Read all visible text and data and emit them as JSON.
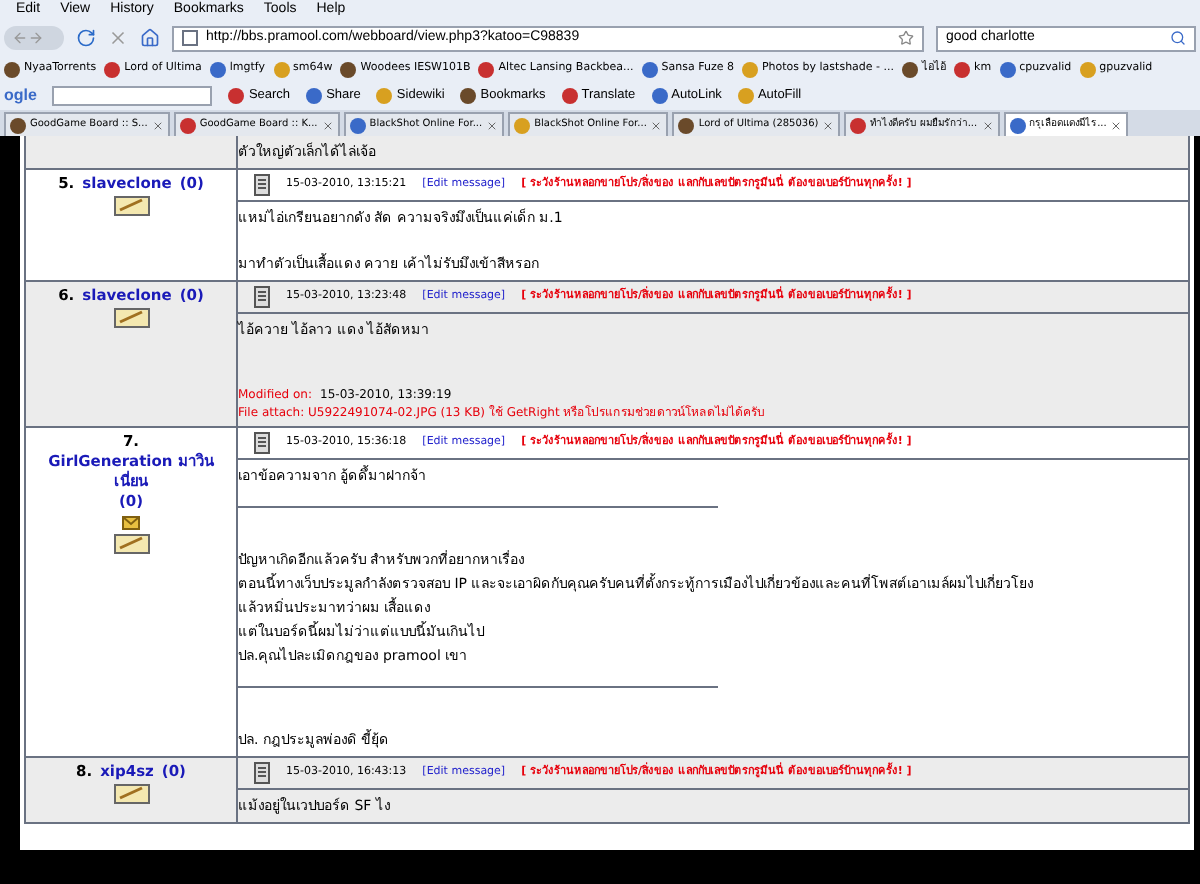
{
  "menu": [
    "Edit",
    "View",
    "History",
    "Bookmarks",
    "Tools",
    "Help"
  ],
  "address": {
    "value": "http://bbs.pramool.com/webboard/view.php3?katoo=C98839"
  },
  "search_field": {
    "value": "good charlotte"
  },
  "bookmarks": [
    "NyaaTorrents",
    "Lord of Ultima",
    "lmgtfy",
    "sm64w",
    "Woodees IESW101B",
    "Altec Lansing Backbea...",
    "Sansa Fuze 8",
    "Photos by lastshade - ...",
    "ไอไอ้",
    "km",
    "cpuzvalid",
    "gpuzvalid"
  ],
  "google_toolbar": {
    "logo": "ogle",
    "items": [
      "Search",
      "Share",
      "Sidewiki",
      "Bookmarks",
      "Translate",
      "AutoLink",
      "AutoFill"
    ]
  },
  "tabs": [
    {
      "label": "GoodGame Board :: S...",
      "selected": false
    },
    {
      "label": "GoodGame Board :: K...",
      "selected": false
    },
    {
      "label": "BlackShot Online For...",
      "selected": false
    },
    {
      "label": "BlackShot Online For...",
      "selected": false
    },
    {
      "label": "Lord of Ultima (285036)",
      "selected": false
    },
    {
      "label": "ทำไงดีครับ ผมยืมรักว่า...",
      "selected": false
    },
    {
      "label": "กรุเลือดแดงมีไร...",
      "selected": true
    }
  ],
  "posts": [
    {
      "body": [
        {
          "kind": "text",
          "text": "ตัวใหญ่ตัวเล็กได้ไล่เจ้อ"
        }
      ]
    },
    {
      "number": "5.",
      "user": "slaveclone",
      "count": "(0)",
      "date": "15-03-2010, 13:15:21",
      "edit": "[Edit message]",
      "notice": "[ ระวังร้านหลอกขายโปร/สิ่งของ แลกกับเลขบัตรกรูมีนนี่ ต้องขอเบอร์บ้านทุกครั้ง! ]",
      "body": [
        {
          "kind": "text",
          "text": "แหม่ไอ่เกรียนอยากดัง สัด ความจริงมึงเป็นแค่เด็ก ม.1"
        },
        {
          "kind": "gap"
        },
        {
          "kind": "text",
          "text": "มาทำตัวเป็นเสื้อแดง ควาย เค้าไม่รับมึงเข้าสีหรอก"
        }
      ]
    },
    {
      "number": "6.",
      "user": "slaveclone",
      "count": "(0)",
      "date": "15-03-2010, 13:23:48",
      "edit": "[Edit message]",
      "notice": "[ ระวังร้านหลอกขายโปร/สิ่งของ แลกกับเลขบัตรกรูมีนนี่ ต้องขอเบอร์บ้านทุกครั้ง! ]",
      "body": [
        {
          "kind": "text",
          "text": "ไอ้ควาย ไอ้ลาว แดง ไอ้สัดหมา"
        },
        {
          "kind": "gap"
        },
        {
          "kind": "gap"
        },
        {
          "kind": "modified",
          "label": "Modified on:",
          "text": "15-03-2010, 13:39:19"
        },
        {
          "kind": "attach",
          "text": "File attach: U5922491074-02.JPG (13 KB) ใช้ GetRight หรือโปรแกรมช่วยดาวน์โหลดไม่ได้ครับ"
        }
      ]
    },
    {
      "number": "7.",
      "user": "GirlGeneration มาวินเนี่ยน",
      "count": "(0)",
      "mail": true,
      "date": "15-03-2010, 15:36:18",
      "edit": "[Edit message]",
      "notice": "[ ระวังร้านหลอกขายโปร/สิ่งของ แลกกับเลขบัตรกรูมีนนี่ ต้องขอเบอร์บ้านทุกครั้ง! ]",
      "body": [
        {
          "kind": "text",
          "text": "เอาข้อความจาก อู้ดดึ้มาฝากจ้า"
        },
        {
          "kind": "rule"
        },
        {
          "kind": "gap"
        },
        {
          "kind": "text",
          "text": "ปัญหาเกิดอีกแล้วครับ สำหรับพวกที่อยากหาเรื่อง"
        },
        {
          "kind": "text",
          "text": "ตอนนี้ทางเว็บประมูลกำลังตรวจสอบ IP และจะเอาผิดกับคุณครับคนที่ตั้งกระทู้การเมืองไปเกี่ยวข้องและคนที่โพสต์เอาเมล์ผมไปเกี่ยวโยง"
        },
        {
          "kind": "text",
          "text": "แล้วหมิ่นประมาทว่าผม เสื้อแดง"
        },
        {
          "kind": "text",
          "text": "แต่ในบอร์ดนี้ผมไม่ว่าแต่แบบนี้มันเกินไป"
        },
        {
          "kind": "text",
          "text": "ปล.คุณไปละเมิดกฎของ pramool เขา"
        },
        {
          "kind": "rule"
        },
        {
          "kind": "gap"
        },
        {
          "kind": "text",
          "text": "ปล. กฎประมูลพ่องดิ ขี้ยุ้ด"
        }
      ]
    },
    {
      "number": "8.",
      "user": "xip4sz",
      "count": "(0)",
      "date": "15-03-2010, 16:43:13",
      "edit": "[Edit message]",
      "notice": "[ ระวังร้านหลอกขายโปร/สิ่งของ แลกกับเลขบัตรกรูมีนนี่ ต้องขอเบอร์บ้านทุกครั้ง! ]",
      "body": [
        {
          "kind": "text",
          "text": "แม้งอยู่ในเวปบอร์ด SF ไง"
        }
      ]
    }
  ]
}
